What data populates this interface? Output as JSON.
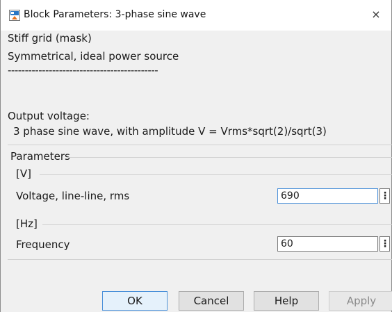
{
  "window": {
    "title": "Block Parameters: 3-phase sine wave",
    "close_glyph": "×",
    "icon": "simulink-block-icon"
  },
  "mask": {
    "type": "Stiff grid (mask)",
    "description_line1": "Symmetrical, ideal power source",
    "separator": "--------------------------------------------",
    "output_line1": "Output voltage:",
    "output_line2": "3 phase sine wave, with amplitude V = Vrms*sqrt(2)/sqrt(3)"
  },
  "parameters": {
    "title": "Parameters",
    "groups": [
      {
        "unit": "[V]",
        "label": "Voltage, line-line, rms",
        "value": "690",
        "focused": true
      },
      {
        "unit": "[Hz]",
        "label": "Frequency",
        "value": "60",
        "focused": false
      }
    ],
    "menu_glyph": "⋮"
  },
  "buttons": {
    "ok": "OK",
    "cancel": "Cancel",
    "help": "Help",
    "apply": "Apply"
  },
  "colors": {
    "accent": "#4a90d9",
    "dialog_bg": "#f0f0f0"
  }
}
